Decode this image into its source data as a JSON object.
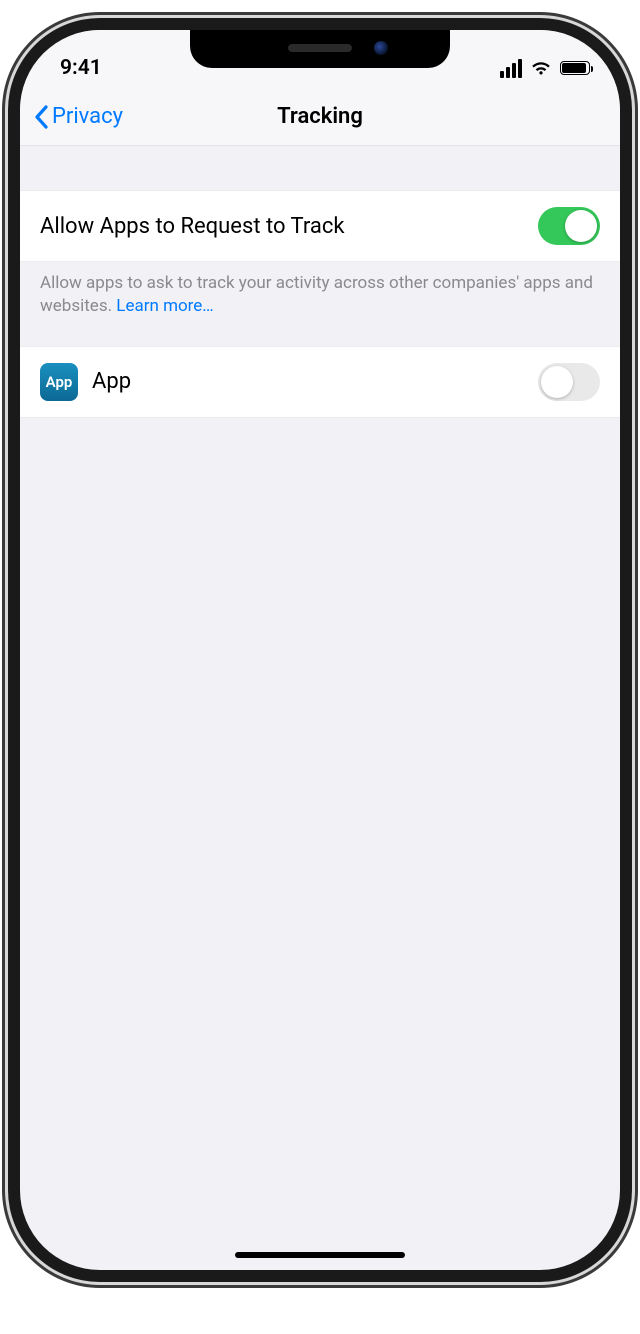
{
  "status_bar": {
    "time": "9:41"
  },
  "nav": {
    "back_label": "Privacy",
    "title": "Tracking"
  },
  "allow_row": {
    "label": "Allow Apps to Request to Track",
    "toggle_on": true
  },
  "footer": {
    "text": "Allow apps to ask to track your activity across other companies' apps and websites. ",
    "learn_more": "Learn more…"
  },
  "app_row": {
    "icon_text": "App",
    "label": "App",
    "toggle_on": false
  }
}
